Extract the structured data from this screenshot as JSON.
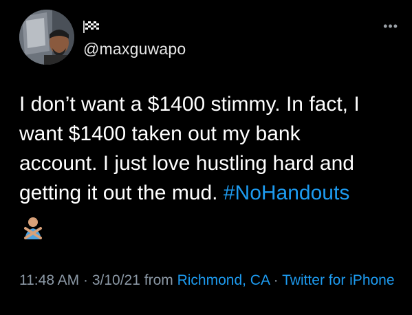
{
  "user": {
    "handle": "@maxguwapo",
    "display_name_icon": "checkered-flag-icon"
  },
  "more_icon": "more-dots-icon",
  "tweet": {
    "text_parts": [
      "I don’t want a $1400 stimmy. In fact, I",
      "want $1400 taken out my bank",
      "account. I just love hustling hard and",
      "getting it out the mud. "
    ],
    "hashtag": "#NoHandouts",
    "emoji": "person-gesturing-no-emoji"
  },
  "meta": {
    "time": "11:48 AM",
    "sep1": " · ",
    "date": "3/10/21",
    "from": " from ",
    "location": "Richmond, CA",
    "sep2": " · ",
    "source": "Twitter for iPhone"
  },
  "colors": {
    "background": "#000000",
    "text": "#ffffff",
    "link": "#1d9bf0",
    "muted": "#8b98a5"
  }
}
